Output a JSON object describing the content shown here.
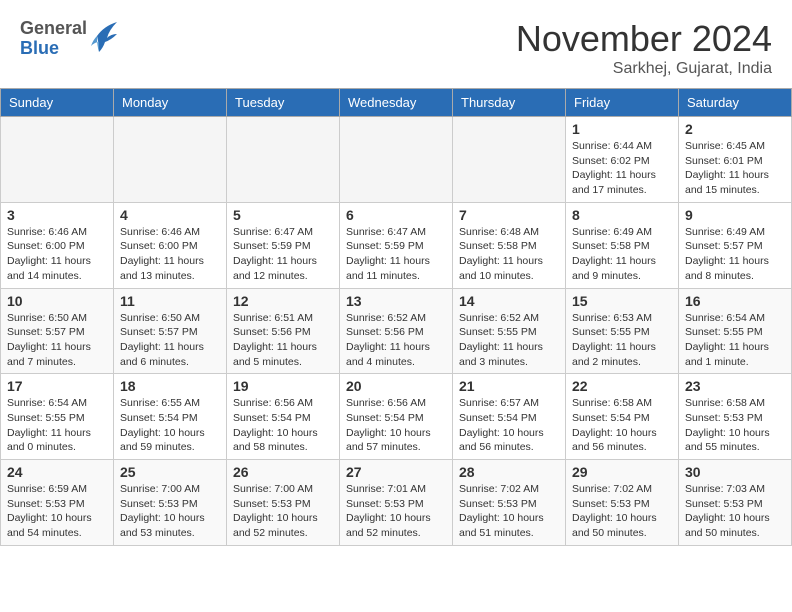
{
  "header": {
    "logo": {
      "line1": "General",
      "line2": "Blue"
    },
    "title": "November 2024",
    "location": "Sarkhej, Gujarat, India"
  },
  "weekdays": [
    "Sunday",
    "Monday",
    "Tuesday",
    "Wednesday",
    "Thursday",
    "Friday",
    "Saturday"
  ],
  "weeks": [
    [
      {
        "day": "",
        "empty": true
      },
      {
        "day": "",
        "empty": true
      },
      {
        "day": "",
        "empty": true
      },
      {
        "day": "",
        "empty": true
      },
      {
        "day": "",
        "empty": true
      },
      {
        "day": "1",
        "info": "Sunrise: 6:44 AM\nSunset: 6:02 PM\nDaylight: 11 hours and 17 minutes."
      },
      {
        "day": "2",
        "info": "Sunrise: 6:45 AM\nSunset: 6:01 PM\nDaylight: 11 hours and 15 minutes."
      }
    ],
    [
      {
        "day": "3",
        "info": "Sunrise: 6:46 AM\nSunset: 6:00 PM\nDaylight: 11 hours and 14 minutes."
      },
      {
        "day": "4",
        "info": "Sunrise: 6:46 AM\nSunset: 6:00 PM\nDaylight: 11 hours and 13 minutes."
      },
      {
        "day": "5",
        "info": "Sunrise: 6:47 AM\nSunset: 5:59 PM\nDaylight: 11 hours and 12 minutes."
      },
      {
        "day": "6",
        "info": "Sunrise: 6:47 AM\nSunset: 5:59 PM\nDaylight: 11 hours and 11 minutes."
      },
      {
        "day": "7",
        "info": "Sunrise: 6:48 AM\nSunset: 5:58 PM\nDaylight: 11 hours and 10 minutes."
      },
      {
        "day": "8",
        "info": "Sunrise: 6:49 AM\nSunset: 5:58 PM\nDaylight: 11 hours and 9 minutes."
      },
      {
        "day": "9",
        "info": "Sunrise: 6:49 AM\nSunset: 5:57 PM\nDaylight: 11 hours and 8 minutes."
      }
    ],
    [
      {
        "day": "10",
        "info": "Sunrise: 6:50 AM\nSunset: 5:57 PM\nDaylight: 11 hours and 7 minutes."
      },
      {
        "day": "11",
        "info": "Sunrise: 6:50 AM\nSunset: 5:57 PM\nDaylight: 11 hours and 6 minutes."
      },
      {
        "day": "12",
        "info": "Sunrise: 6:51 AM\nSunset: 5:56 PM\nDaylight: 11 hours and 5 minutes."
      },
      {
        "day": "13",
        "info": "Sunrise: 6:52 AM\nSunset: 5:56 PM\nDaylight: 11 hours and 4 minutes."
      },
      {
        "day": "14",
        "info": "Sunrise: 6:52 AM\nSunset: 5:55 PM\nDaylight: 11 hours and 3 minutes."
      },
      {
        "day": "15",
        "info": "Sunrise: 6:53 AM\nSunset: 5:55 PM\nDaylight: 11 hours and 2 minutes."
      },
      {
        "day": "16",
        "info": "Sunrise: 6:54 AM\nSunset: 5:55 PM\nDaylight: 11 hours and 1 minute."
      }
    ],
    [
      {
        "day": "17",
        "info": "Sunrise: 6:54 AM\nSunset: 5:55 PM\nDaylight: 11 hours and 0 minutes."
      },
      {
        "day": "18",
        "info": "Sunrise: 6:55 AM\nSunset: 5:54 PM\nDaylight: 10 hours and 59 minutes."
      },
      {
        "day": "19",
        "info": "Sunrise: 6:56 AM\nSunset: 5:54 PM\nDaylight: 10 hours and 58 minutes."
      },
      {
        "day": "20",
        "info": "Sunrise: 6:56 AM\nSunset: 5:54 PM\nDaylight: 10 hours and 57 minutes."
      },
      {
        "day": "21",
        "info": "Sunrise: 6:57 AM\nSunset: 5:54 PM\nDaylight: 10 hours and 56 minutes."
      },
      {
        "day": "22",
        "info": "Sunrise: 6:58 AM\nSunset: 5:54 PM\nDaylight: 10 hours and 56 minutes."
      },
      {
        "day": "23",
        "info": "Sunrise: 6:58 AM\nSunset: 5:53 PM\nDaylight: 10 hours and 55 minutes."
      }
    ],
    [
      {
        "day": "24",
        "info": "Sunrise: 6:59 AM\nSunset: 5:53 PM\nDaylight: 10 hours and 54 minutes."
      },
      {
        "day": "25",
        "info": "Sunrise: 7:00 AM\nSunset: 5:53 PM\nDaylight: 10 hours and 53 minutes."
      },
      {
        "day": "26",
        "info": "Sunrise: 7:00 AM\nSunset: 5:53 PM\nDaylight: 10 hours and 52 minutes."
      },
      {
        "day": "27",
        "info": "Sunrise: 7:01 AM\nSunset: 5:53 PM\nDaylight: 10 hours and 52 minutes."
      },
      {
        "day": "28",
        "info": "Sunrise: 7:02 AM\nSunset: 5:53 PM\nDaylight: 10 hours and 51 minutes."
      },
      {
        "day": "29",
        "info": "Sunrise: 7:02 AM\nSunset: 5:53 PM\nDaylight: 10 hours and 50 minutes."
      },
      {
        "day": "30",
        "info": "Sunrise: 7:03 AM\nSunset: 5:53 PM\nDaylight: 10 hours and 50 minutes."
      }
    ]
  ]
}
